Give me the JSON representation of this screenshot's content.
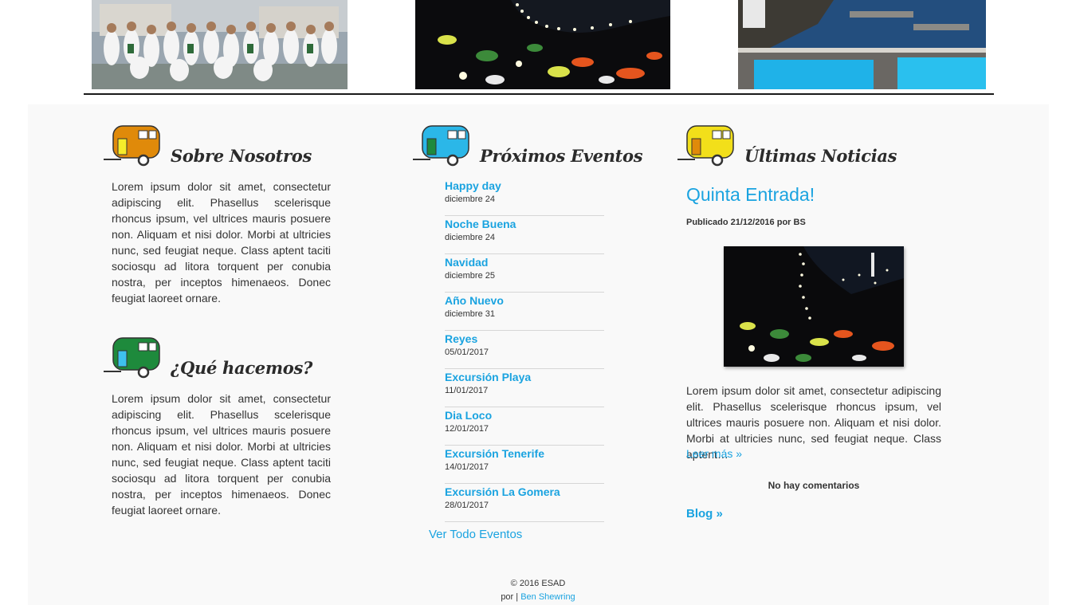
{
  "gallery": [
    {
      "alt": "group-photo"
    },
    {
      "alt": "night-run-photo"
    },
    {
      "alt": "pool-coast-photo"
    }
  ],
  "sections": {
    "about": {
      "title": "Sobre Nosotros",
      "text": "Lorem ipsum dolor sit amet, consectetur adipiscing elit. Phasellus scelerisque rhoncus ipsum, vel ultrices mauris posuere non. Aliquam et nisi dolor. Morbi at ultricies nunc, sed feugiat neque. Class aptent taciti sociosqu ad litora torquent per conubia nostra, per inceptos himenaeos. Donec feugiat laoreet ornare.",
      "icon_color": "#e08a0a"
    },
    "what": {
      "title": "¿Qué hacemos?",
      "text": "Lorem ipsum dolor sit amet, consectetur adipiscing elit. Phasellus scelerisque rhoncus ipsum, vel ultrices mauris posuere non. Aliquam et nisi dolor. Morbi at ultricies nunc, sed feugiat neque. Class aptent taciti sociosqu ad litora torquent per conubia nostra, per inceptos himenaeos. Donec feugiat laoreet ornare.",
      "icon_color": "#1e8a3c"
    },
    "events": {
      "title": "Próximos Eventos",
      "icon_color": "#2bb7e8",
      "items": [
        {
          "title": "Happy day",
          "date": "diciembre 24"
        },
        {
          "title": "Noche Buena",
          "date": "diciembre 24"
        },
        {
          "title": "Navidad",
          "date": "diciembre 25"
        },
        {
          "title": "Año Nuevo",
          "date": "diciembre 31"
        },
        {
          "title": "Reyes",
          "date": "05/01/2017"
        },
        {
          "title": "Excursión Playa",
          "date": "11/01/2017"
        },
        {
          "title": "Dia Loco",
          "date": "12/01/2017"
        },
        {
          "title": "Excursión Tenerife",
          "date": "14/01/2017"
        },
        {
          "title": "Excursión La Gomera",
          "date": "28/01/2017"
        }
      ],
      "view_all": "Ver Todo Eventos"
    },
    "news": {
      "title": "Últimas Noticias",
      "icon_color": "#f2df1a",
      "post_title": "Quinta Entrada!",
      "post_meta": "Publicado 21/12/2016 por BS",
      "excerpt": "Lorem ipsum dolor sit amet, consectetur adipiscing elit. Phasellus scelerisque rhoncus ipsum, vel ultrices mauris posuere non. Aliquam et nisi dolor. Morbi at ultricies nunc, sed feugiat neque. Class aptent…",
      "read_more": "Leer más »",
      "comments": "No hay comentarios",
      "blog_link": "Blog »"
    }
  },
  "footer": {
    "copyright": "© 2016 ESAD",
    "by_prefix": "por |",
    "author": "Ben Shewring"
  },
  "colors": {
    "accent": "#1aa3e0",
    "text": "#333333",
    "content_bg": "#f9f9f9"
  }
}
